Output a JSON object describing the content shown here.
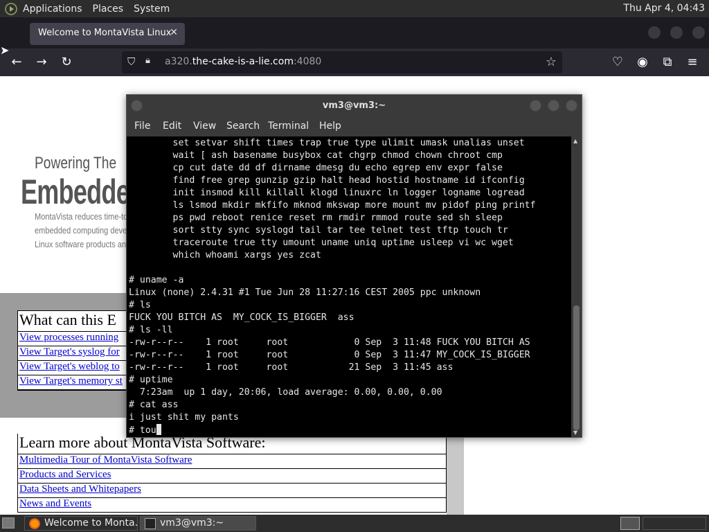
{
  "top_panel": {
    "menus": [
      "Applications",
      "Places",
      "System"
    ],
    "clock": "Thu Apr  4, 04:43"
  },
  "browser": {
    "tab_title": "Welcome to MontaVista Linux",
    "url_prefix": "a320.",
    "url_domain": "the-cake-is-a-lie.com",
    "url_suffix": ":4080"
  },
  "page": {
    "powering": "Powering The",
    "embedded": "Embeddec",
    "intro": [
      "MontaVista reduces time-to",
      "embedded computing deve",
      "Linux software products an"
    ],
    "box1": {
      "heading": "What can this E",
      "links": [
        "View processes running",
        "View Target's syslog for",
        "View Target's weblog to",
        "View Target's memory st"
      ]
    },
    "box2": {
      "heading": "Learn more about MontaVista Software:",
      "links": [
        "Multimedia Tour of MontaVista Software",
        "Products and Services",
        "Data Sheets and Whitepapers",
        "News and Events"
      ]
    }
  },
  "terminal": {
    "title": "vm3@vm3:~",
    "menus": [
      "File",
      "Edit",
      "View",
      "Search",
      "Terminal",
      "Help"
    ],
    "lines": [
      "        set setvar shift times trap true type ulimit umask unalias unset",
      "        wait [ ash basename busybox cat chgrp chmod chown chroot cmp",
      "        cp cut date dd df dirname dmesg du echo egrep env expr false",
      "        find free grep gunzip gzip halt head hostid hostname id ifconfig",
      "        init insmod kill killall klogd linuxrc ln logger logname logread",
      "        ls lsmod mkdir mkfifo mknod mkswap more mount mv pidof ping printf",
      "        ps pwd reboot renice reset rm rmdir rmmod route sed sh sleep",
      "        sort stty sync syslogd tail tar tee telnet test tftp touch tr",
      "        traceroute true tty umount uname uniq uptime usleep vi wc wget",
      "        which whoami xargs yes zcat",
      "",
      "# uname -a",
      "Linux (none) 2.4.31 #1 Tue Jun 28 11:27:16 CEST 2005 ppc unknown",
      "# ls",
      "FUCK YOU BITCH AS  MY_COCK_IS_BIGGER  ass",
      "# ls -ll",
      "-rw-r--r--    1 root     root            0 Sep  3 11:48 FUCK YOU BITCH AS",
      "-rw-r--r--    1 root     root            0 Sep  3 11:47 MY_COCK_IS_BIGGER",
      "-rw-r--r--    1 root     root           21 Sep  3 11:45 ass",
      "# uptime",
      "  7:23am  up 1 day, 20:06, load average: 0.00, 0.00, 0.00",
      "# cat ass",
      "i just shit my pants"
    ],
    "prompt_line": "# tou"
  },
  "taskbar": {
    "tasks": [
      "Welcome to Monta...",
      "vm3@vm3:~"
    ]
  }
}
